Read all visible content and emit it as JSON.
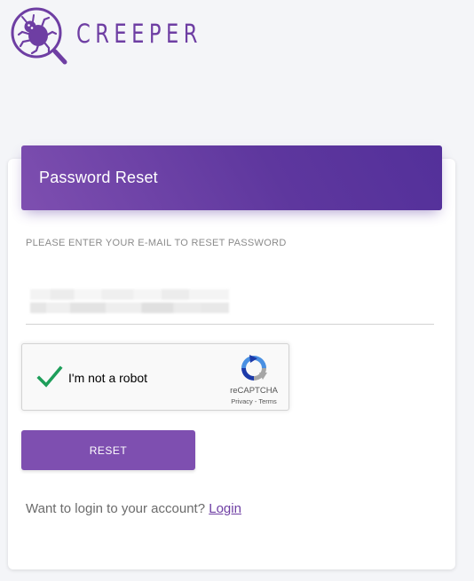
{
  "brand": {
    "name": "CREEPER",
    "color": "#6e3ea3"
  },
  "card": {
    "title": "Password Reset",
    "header_gradient": [
      "#7e4fb0",
      "#53309a"
    ]
  },
  "form": {
    "instruction": "PLEASE ENTER YOUR E-MAIL TO RESET PASSWORD",
    "email": {
      "value": "",
      "placeholder": "",
      "redacted": true
    },
    "reset_label": "RESET"
  },
  "recaptcha": {
    "label": "I'm not a robot",
    "brand": "reCAPTCHA",
    "privacy": "Privacy",
    "separator": " - ",
    "terms": "Terms",
    "checked": true,
    "check_color": "#1e9e5a"
  },
  "footer": {
    "prompt": "Want to login to your account? ",
    "login_label": "Login"
  },
  "icons": {
    "logo": "bug-magnifier-icon",
    "check": "checkmark-icon",
    "recaptcha": "recaptcha-logo-icon"
  }
}
